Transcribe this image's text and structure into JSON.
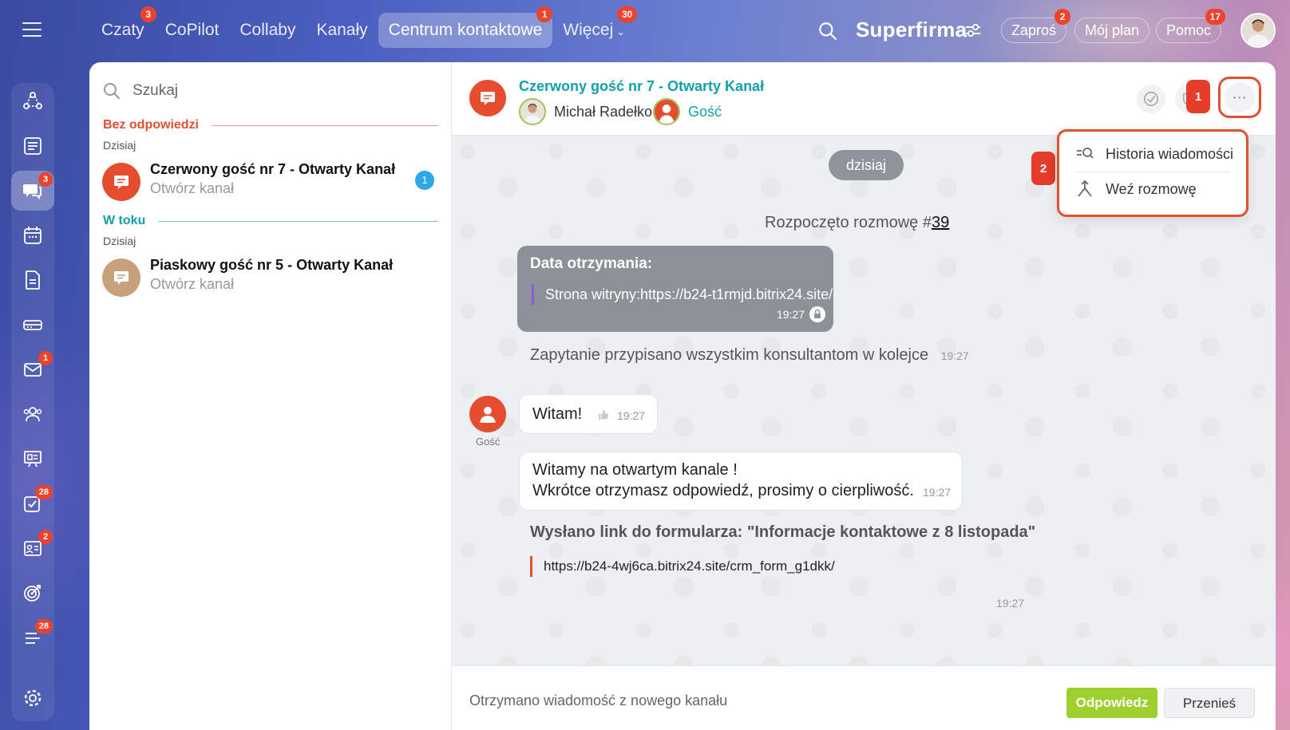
{
  "colors": {
    "accent_teal": "#11a1a8",
    "accent_orange": "#e2512c",
    "badge_red": "#f0412b",
    "reply_green": "#9dcf2e",
    "counter_blue": "#2fa7e6",
    "guest_sand": "#c7a17c"
  },
  "topnav": {
    "items": [
      {
        "label": "Czaty",
        "badge": "3"
      },
      {
        "label": "CoPilot",
        "badge": ""
      },
      {
        "label": "Collaby",
        "badge": ""
      },
      {
        "label": "Kanały",
        "badge": ""
      },
      {
        "label": "Centrum kontaktowe",
        "badge": "1"
      },
      {
        "label": "Więcej",
        "badge": "30"
      }
    ],
    "brand": "Superfirma",
    "pills": [
      {
        "label": "Zaproś",
        "badge": "2"
      },
      {
        "label": "Mój plan",
        "badge": ""
      },
      {
        "label": "Pomoc",
        "badge": "17"
      }
    ]
  },
  "sidebar": {
    "badges": {
      "chats": "3",
      "mail": "1",
      "tasks": "28",
      "crm": "2",
      "feed": "28"
    }
  },
  "list": {
    "search_placeholder": "Szukaj",
    "section_unanswered": "Bez odpowiedzi",
    "section_in_progress": "W toku",
    "day_label": "Dzisiaj",
    "chats": [
      {
        "title": "Czerwony gość nr 7 - Otwarty Kanał",
        "subtitle": "Otwórz kanał",
        "counter": "1"
      },
      {
        "title": "Piaskowy gość nr 5 - Otwarty Kanał",
        "subtitle": "Otwórz kanał",
        "counter": ""
      }
    ]
  },
  "chat": {
    "title": "Czerwony gość nr 7 - Otwarty Kanał",
    "operator_name": "Michał Radełko",
    "guest_name": "Gość",
    "menu": {
      "history": "Historia wiadomości",
      "take": "Weź rozmowę"
    },
    "steps": [
      "1",
      "2"
    ],
    "date_chip": "dzisiaj",
    "started_prefix": "Rozpoczęto rozmowę #",
    "started_number": "39",
    "data_card": {
      "title": "Data otrzymania:",
      "quote": "Strona witryny:https://b24-t1rmjd.bitrix24.site/",
      "time": "19:27"
    },
    "assigned_text": "Zapytanie przypisano wszystkim konsultantom w kolejce",
    "assigned_time": "19:27",
    "guest_label": "Gość",
    "msg_guest": {
      "text": "Witam!",
      "time": "19:27"
    },
    "msg_welcome": {
      "line1": "Witamy na otwartym kanale !",
      "line2": "Wkrótce otrzymasz odpowiedź, prosimy o cierpliwość.",
      "time": "19:27"
    },
    "form": {
      "title": "Wysłano link do formularza: \"Informacje kontaktowe z 8 listopada\"",
      "link": "https://b24-4wj6ca.bitrix24.site/crm_form_g1dkk/",
      "time": "19:27"
    },
    "footer": {
      "text": "Otrzymano wiadomość z nowego kanału",
      "reply": "Odpowiedz",
      "move": "Przenieś"
    }
  }
}
